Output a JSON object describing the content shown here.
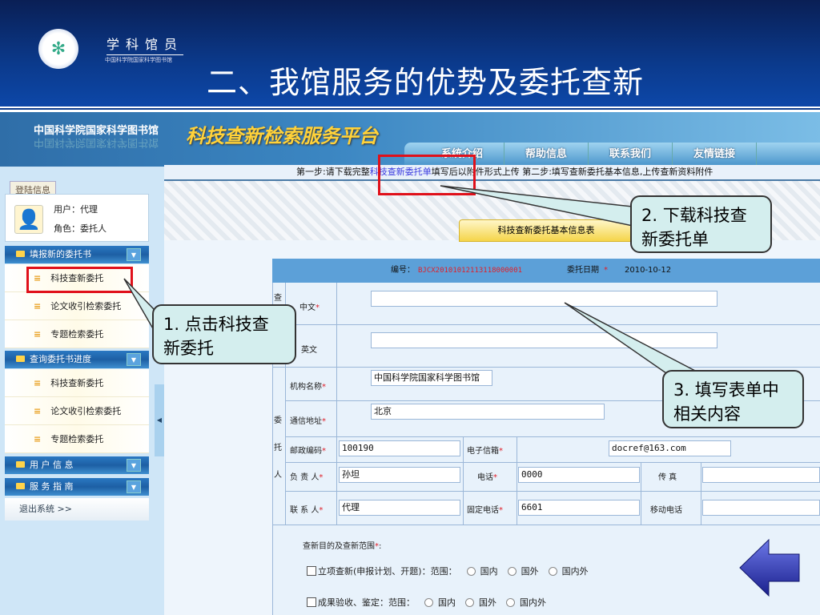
{
  "slide": {
    "brand": "学科馆员",
    "brand_sub": "中国科学院国家科学图书馆",
    "title": "二、我馆服务的优势及委托查新"
  },
  "banner": {
    "library": "中国科学院国家科学图书馆",
    "platform": "科技查新检索服务平台",
    "nav": [
      "系统介绍",
      "帮助信息",
      "联系我们",
      "友情链接"
    ]
  },
  "steps": {
    "pre": "第一步:请下载完整",
    "link": "科技查新委托单",
    "post": "填写后以附件形式上传  第二步:填写查新委托基本信息,上传查新资料附件"
  },
  "sidebar": {
    "login_tab": "登陆信息",
    "user": "用户：代理",
    "role": "角色：委托人",
    "sections": [
      {
        "label": "填报新的委托书",
        "items": [
          "科技查新委托",
          "论文收引检索委托",
          "专题检索委托"
        ]
      },
      {
        "label": "查询委托书进度",
        "items": [
          "科技查新委托",
          "论文收引检索委托",
          "专题检索委托"
        ]
      },
      {
        "label": "用 户 信 息"
      },
      {
        "label": "服 务 指 南"
      }
    ],
    "logout": "退出系统 >>"
  },
  "form": {
    "tab": "科技查新委托基本信息表",
    "no_label": "编号：",
    "no_value": "BJCX20101012113118000001",
    "date_label": "委托日期",
    "date_value": "2010-10-12",
    "req": "*",
    "group1": "查",
    "group2": [
      "委",
      "托",
      "人"
    ],
    "cn_label": "中文",
    "en_label": "英文",
    "org_label": "机构名称",
    "org_value": "中国科学院国家科学图书馆",
    "addr_label": "通信地址",
    "addr_value": "北京",
    "zip_label": "邮政编码",
    "zip_value": "100190",
    "email_label": "电子信箱",
    "email_value": "docref@163.com",
    "head_label": "负 责 人",
    "head_value": "孙坦",
    "phone_label": "电话",
    "phone_value": "0000",
    "fax_label": "传 真",
    "contact_label": "联 系 人",
    "contact_value": "代理",
    "tel_label": "固定电话",
    "tel_value": "6601",
    "mobile_label": "移动电话",
    "purpose_label": "查新目的及查新范围",
    "opt1": "立项查新(申报计划、开题)：范围：",
    "opt2": "成果验收、鉴定：范围：",
    "scopes": [
      "国内",
      "国外",
      "国内外"
    ]
  },
  "callouts": {
    "c1": "1. 点击科技查新委托",
    "c2": "2. 下载科技查新委托单",
    "c3": "3. 填写表单中相关内容"
  }
}
